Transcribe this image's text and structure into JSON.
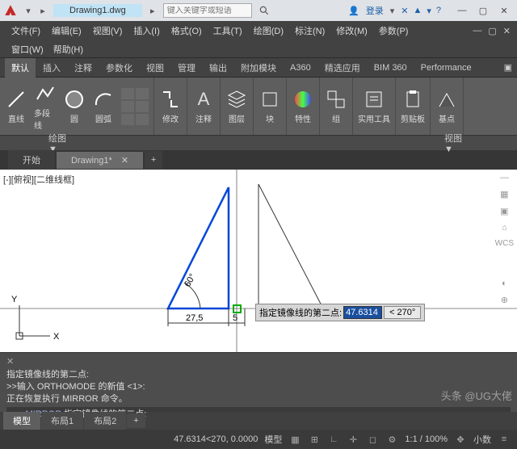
{
  "title": {
    "doc": "Drawing1.dwg",
    "search_placeholder": "键入关键字或短语",
    "login": "登录"
  },
  "menus": [
    "文件(F)",
    "编辑(E)",
    "视图(V)",
    "插入(I)",
    "格式(O)",
    "工具(T)",
    "绘图(D)",
    "标注(N)",
    "修改(M)",
    "参数(P)"
  ],
  "menus2": [
    "窗口(W)",
    "帮助(H)"
  ],
  "ribbon_tabs": [
    "默认",
    "插入",
    "注释",
    "参数化",
    "视图",
    "管理",
    "输出",
    "附加模块",
    "A360",
    "精选应用",
    "BIM 360",
    "Performance"
  ],
  "ribbon_active": 0,
  "tools": {
    "draw": [
      "直线",
      "多段线",
      "圆",
      "圆弧"
    ],
    "modify": "修改",
    "annotate": "注释",
    "layer": "图层",
    "block": "块",
    "props": "特性",
    "group": "组",
    "util": "实用工具",
    "clip": "剪贴板",
    "base": "基点"
  },
  "panel_labels": {
    "draw": "绘图 ▼",
    "view": "视图 ▼"
  },
  "doc_tabs": [
    "开始",
    "Drawing1*"
  ],
  "doc_tab_active": 1,
  "view": {
    "label": "[-][俯视][二维线框]",
    "wcs": "WCS",
    "y": "Y",
    "x": "X",
    "dim1": "27,5",
    "dim2": "5",
    "angle": "60°"
  },
  "prompt": {
    "label": "指定镜像线的第二点:",
    "value": "47.6314",
    "angle": "< 270°"
  },
  "cmd": {
    "l1": "指定镜像线的第二点:",
    "l2": ">>输入 ORTHOMODE 的新值 <1>:",
    "l3": "正在恢复执行 MIRROR 命令。",
    "active_prefix": "MIRROR",
    "active": "指定镜像线的第二点:"
  },
  "layout_tabs": [
    "模型",
    "布局1",
    "布局2"
  ],
  "layout_active": 0,
  "status": {
    "coords": "47.6314<270, 0.0000",
    "mode": "模型",
    "zoom": "1:1 / 100%",
    "decimal": "小数"
  },
  "watermark": "头条 @UG大佬"
}
